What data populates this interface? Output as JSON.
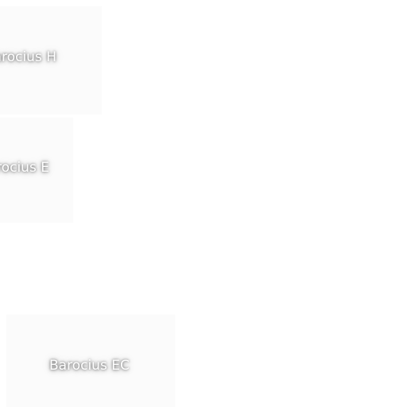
{
  "items": [
    {
      "label": "Barocius H"
    },
    {
      "label": "Barocius E"
    },
    {
      "label": "Barocius EC"
    }
  ],
  "colors": {
    "background": "#ffffff",
    "tile": "#fbfbfb",
    "label_text": "#ffffff"
  }
}
